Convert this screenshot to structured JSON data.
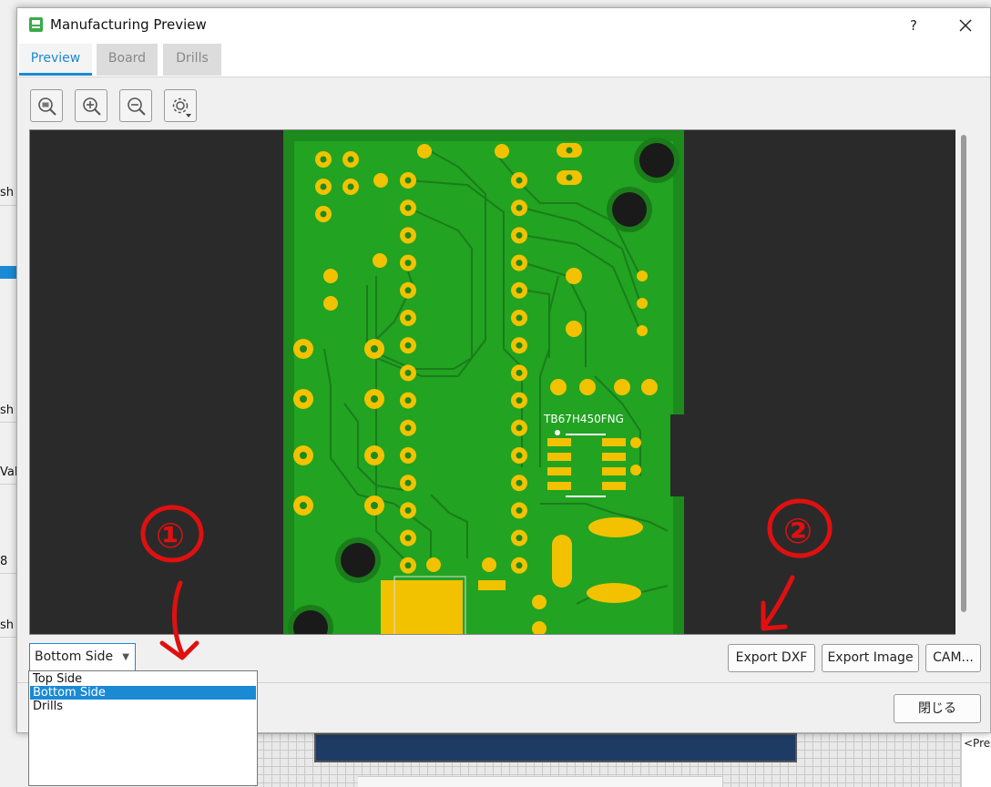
{
  "background_app": {
    "strip_labels": [
      "sh",
      "sh",
      "Val",
      "8",
      "sh"
    ],
    "right_panel_text": "<Pres"
  },
  "dialog": {
    "title": "Manufacturing Preview",
    "help_label": "?",
    "close_label": "✕",
    "tabs": [
      {
        "label": "Preview",
        "active": true
      },
      {
        "label": "Board",
        "active": false
      },
      {
        "label": "Drills",
        "active": false
      }
    ],
    "toolbar_icons": [
      "zoom-fit-icon",
      "zoom-in-icon",
      "zoom-out-icon",
      "settings-icon"
    ],
    "preview": {
      "component_label": "TB67H450FNG",
      "board_color": "#1e9a1e",
      "pad_color": "#f2c200",
      "background_color": "#2a2a2a"
    },
    "side_select": {
      "value": "Bottom Side",
      "options": [
        "Top Side",
        "Bottom Side",
        "Drills"
      ],
      "selected_index": 1
    },
    "buttons": {
      "export_dxf": "Export DXF",
      "export_image": "Export Image",
      "cam": "CAM...",
      "close": "閉じる"
    }
  },
  "annotations": {
    "color": "#e01010",
    "labels": [
      "①",
      "②"
    ]
  }
}
